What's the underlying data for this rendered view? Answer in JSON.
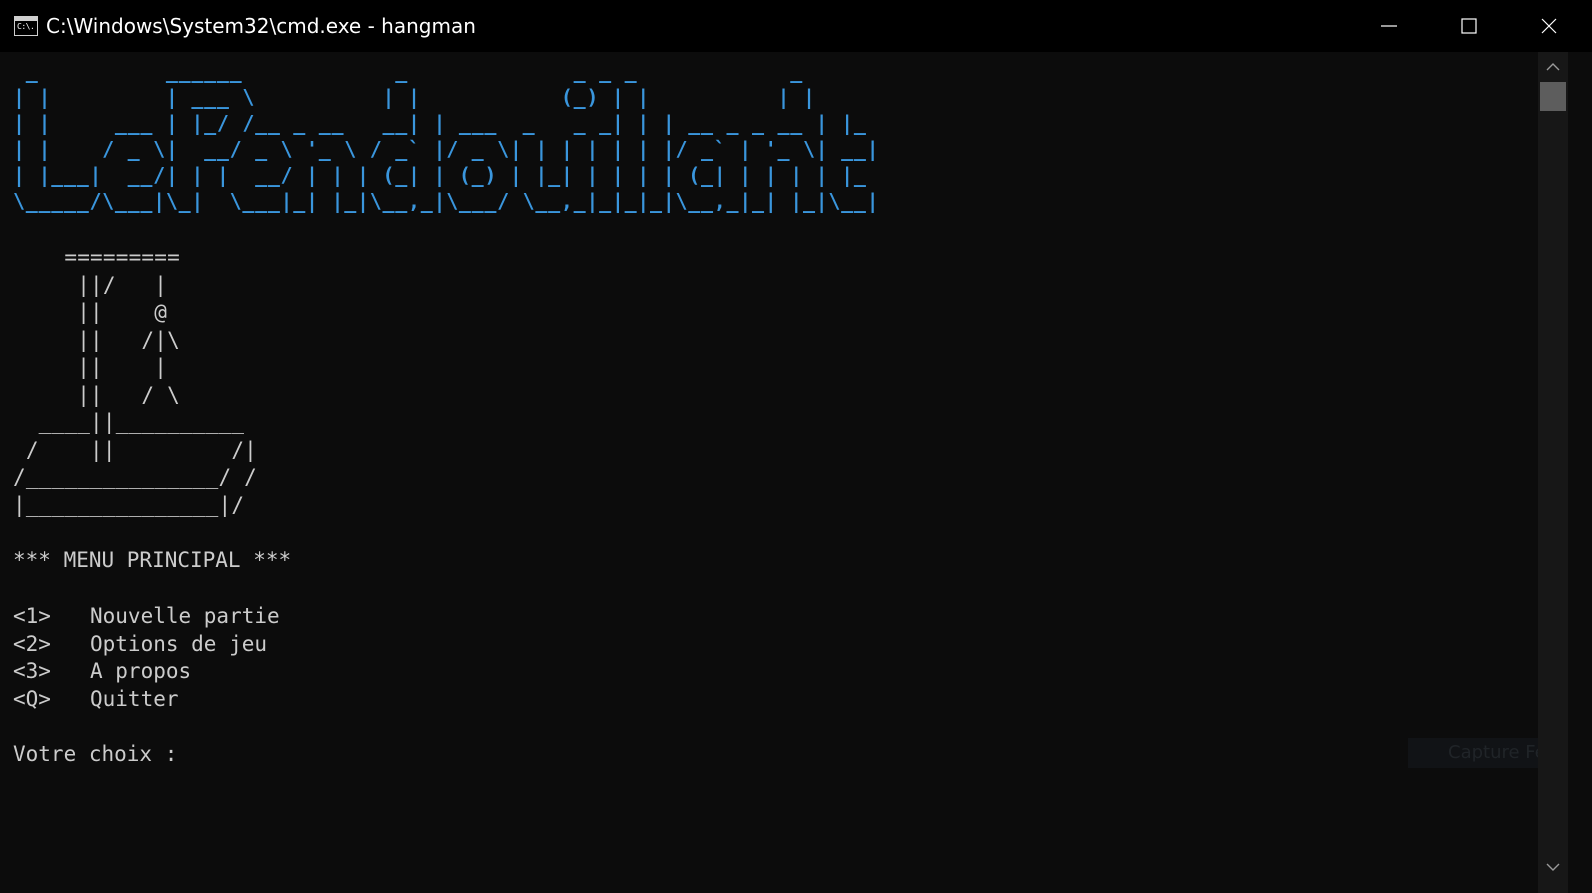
{
  "window": {
    "title": "C:\\Windows\\System32\\cmd.exe - hangman",
    "icon": "cmd-console-icon",
    "icon_text": "C:\\."
  },
  "colors": {
    "background": "#0c0c0c",
    "titlebar": "#000000",
    "text": "#cccccc",
    "logo": "#3a96dd",
    "scrollbar_track": "#171717",
    "scrollbar_thumb": "#5d5d5d"
  },
  "console": {
    "logo_ascii": " _          ______            _             _ _ _            _   \n| |         | ___ \\          | |           (_) | |          | |  \n| |     ___ | |_/ /__ _ __   __| | ___  _   _ _| | | __ _ _ __ | |_ \n| |    / _ \\|  __/ _ \\ '_ \\ / _` |/ _ \\| | | | | | |/ _` | '_ \\| __|\n| |___|  __/| | |  __/ | | | (_| | (_) | |_| | | | | (_| | | | | |_ \n\\_____/\\___|\\_|  \\___|_| |_|\\__,_|\\___/ \\__,_|_|_|_|\\__,_|_| |_|\\__|",
    "gallows_ascii": "    =========\n     ||/   |\n     ||    @\n     ||   /|\\\n     ||    |\n     ||   / \\\n  ____||__________\n /    ||         /|\n/_______________/ /\n|_______________|/",
    "menu_title": "*** MENU PRINCIPAL ***",
    "menu_items": [
      {
        "key": "<1>",
        "label": "Nouvelle partie"
      },
      {
        "key": "<2>",
        "label": "Options de jeu"
      },
      {
        "key": "<3>",
        "label": "A propos"
      },
      {
        "key": "<Q>",
        "label": "Quitter"
      }
    ],
    "prompt": "Votre choix :"
  },
  "overlay": {
    "ghost_text": "Capture Fen"
  }
}
